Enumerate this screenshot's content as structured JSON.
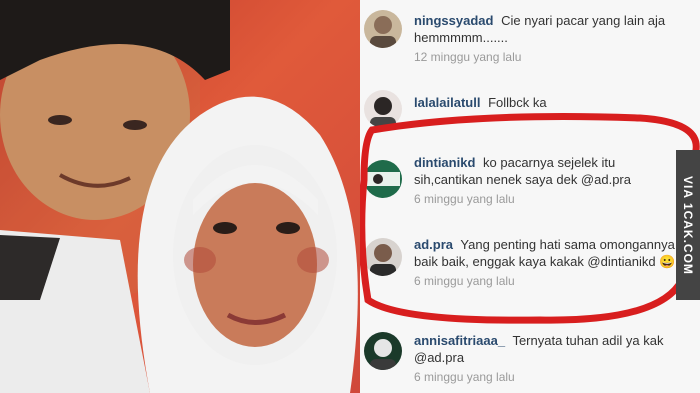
{
  "comments": [
    {
      "username": "ningssyadad",
      "text": "Cie nyari pacar yang lain aja hemmmmm.......",
      "time": "12 minggu yang lalu"
    },
    {
      "username": "lalalailatull",
      "text": "Follbck ka",
      "time": ""
    },
    {
      "username": "dintianikd",
      "text": "ko pacarnya sejelek itu sih,cantikan nenek saya dek @ad.pra",
      "time": "6 minggu yang lalu"
    },
    {
      "username": "ad.pra",
      "text": "Yang penting hati sama omongannya baik baik, enggak kaya kakak @dintianikd 😀",
      "time": "6 minggu yang lalu"
    },
    {
      "username": "annisafitriaaa_",
      "text": "Ternyata tuhan adil ya kak @ad.pra",
      "time": "6 minggu yang lalu"
    }
  ],
  "watermark": "VIA 1CAK.COM",
  "colors": {
    "username": "#2a4a6e",
    "highlight_ellipse": "#d81e1e",
    "photo_background": "#d0483a"
  }
}
